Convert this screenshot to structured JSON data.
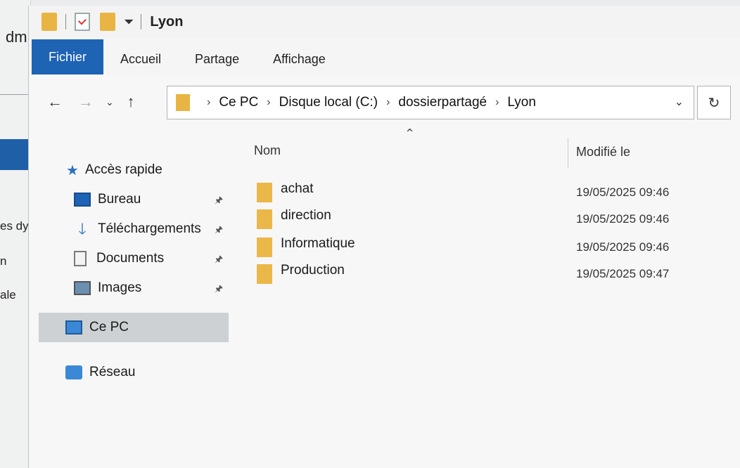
{
  "background_window": {
    "title_fragment": "dm",
    "text_fragments": [
      "es dy",
      "n",
      "ale"
    ]
  },
  "window": {
    "title": "Lyon"
  },
  "ribbon": {
    "tabs": [
      {
        "label": "Fichier",
        "active": true
      },
      {
        "label": "Accueil",
        "active": false
      },
      {
        "label": "Partage",
        "active": false
      },
      {
        "label": "Affichage",
        "active": false
      }
    ]
  },
  "address": {
    "breadcrumb": [
      "Ce PC",
      "Disque local (C:)",
      "dossierpartagé",
      "Lyon"
    ]
  },
  "navigation": {
    "quick_access_label": "Accès rapide",
    "pinned": [
      {
        "label": "Bureau",
        "icon": "desktop-icon"
      },
      {
        "label": "Téléchargements",
        "icon": "download-icon"
      },
      {
        "label": "Documents",
        "icon": "documents-icon"
      },
      {
        "label": "Images",
        "icon": "images-icon"
      }
    ],
    "this_pc_label": "Ce PC",
    "network_label": "Réseau"
  },
  "file_list": {
    "columns": {
      "name": "Nom",
      "modified": "Modifié le"
    },
    "items": [
      {
        "name": "achat",
        "modified": "19/05/2025 09:46"
      },
      {
        "name": "direction",
        "modified": "19/05/2025 09:46"
      },
      {
        "name": "Informatique",
        "modified": "19/05/2025 09:46"
      },
      {
        "name": "Production",
        "modified": "19/05/2025 09:47"
      }
    ]
  },
  "colors": {
    "accent": "#1e63b4",
    "folder": "#e8b544",
    "selected_nav": "#cdd1d4"
  }
}
